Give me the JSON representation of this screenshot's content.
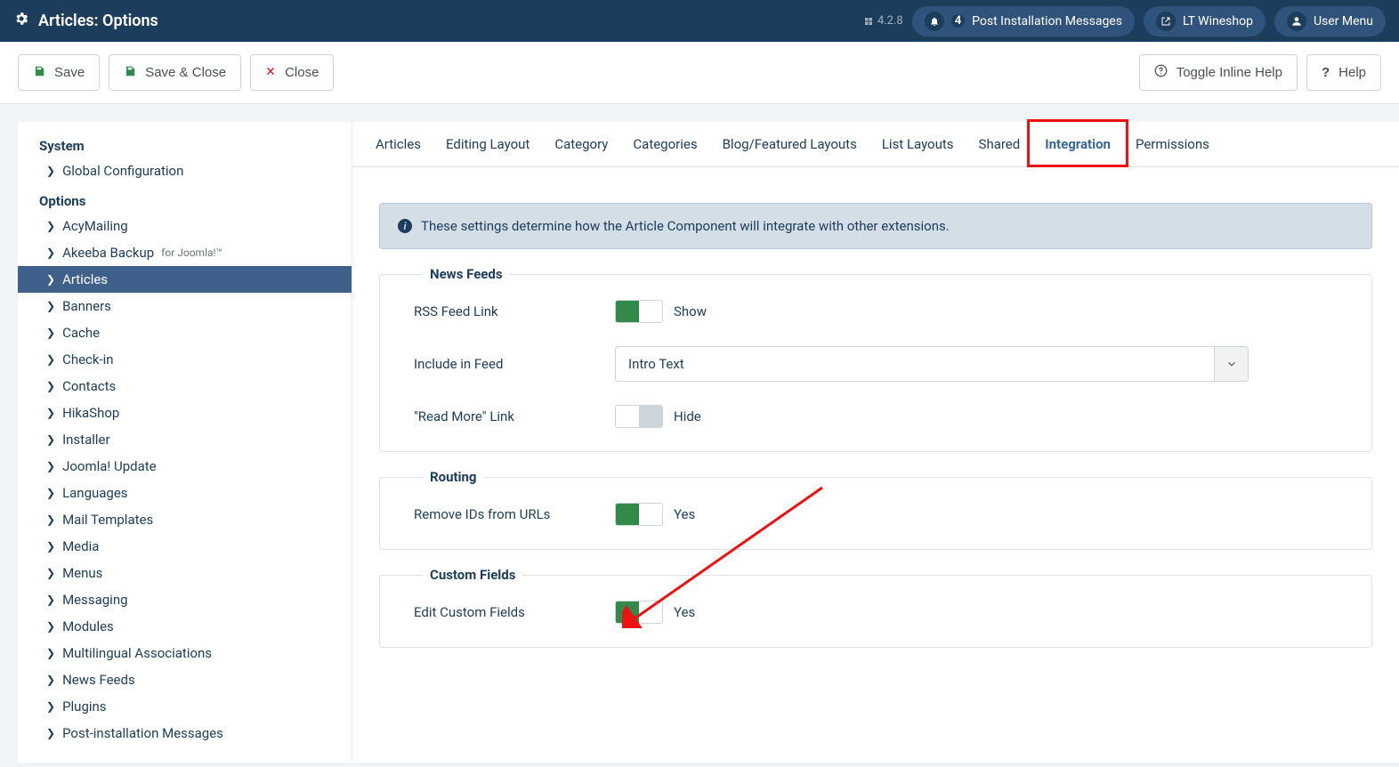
{
  "topbar": {
    "title": "Articles: Options",
    "version": "4.2.8",
    "notifications": {
      "count": "4",
      "label": "Post Installation Messages"
    },
    "site": "LT Wineshop",
    "userMenu": "User Menu"
  },
  "toolbar": {
    "save": "Save",
    "saveClose": "Save & Close",
    "close": "Close",
    "toggleHelp": "Toggle Inline Help",
    "help": "Help"
  },
  "sidebar": {
    "systemHeading": "System",
    "globalConfig": "Global Configuration",
    "optionsHeading": "Options",
    "items": [
      "AcyMailing",
      "Akeeba Backup",
      "Articles",
      "Banners",
      "Cache",
      "Check-in",
      "Contacts",
      "HikaShop",
      "Installer",
      "Joomla! Update",
      "Languages",
      "Mail Templates",
      "Media",
      "Menus",
      "Messaging",
      "Modules",
      "Multilingual Associations",
      "News Feeds",
      "Plugins",
      "Post-installation Messages"
    ],
    "akeebaSuffix": "for Joomla!™"
  },
  "tabs": {
    "items": [
      "Articles",
      "Editing Layout",
      "Category",
      "Categories",
      "Blog/Featured Layouts",
      "List Layouts",
      "Shared",
      "Integration",
      "Permissions"
    ],
    "active": "Integration"
  },
  "alert": "These settings determine how the Article Component will integrate with other extensions.",
  "fieldsets": {
    "newsFeeds": {
      "legend": "News Feeds",
      "rssFeedLabel": "RSS Feed Link",
      "rssFeedValue": "Show",
      "includeFeedLabel": "Include in Feed",
      "includeFeedValue": "Intro Text",
      "readMoreLabel": "\"Read More\" Link",
      "readMoreValue": "Hide"
    },
    "routing": {
      "legend": "Routing",
      "removeIdsLabel": "Remove IDs from URLs",
      "removeIdsValue": "Yes"
    },
    "customFields": {
      "legend": "Custom Fields",
      "editLabel": "Edit Custom Fields",
      "editValue": "Yes"
    }
  }
}
